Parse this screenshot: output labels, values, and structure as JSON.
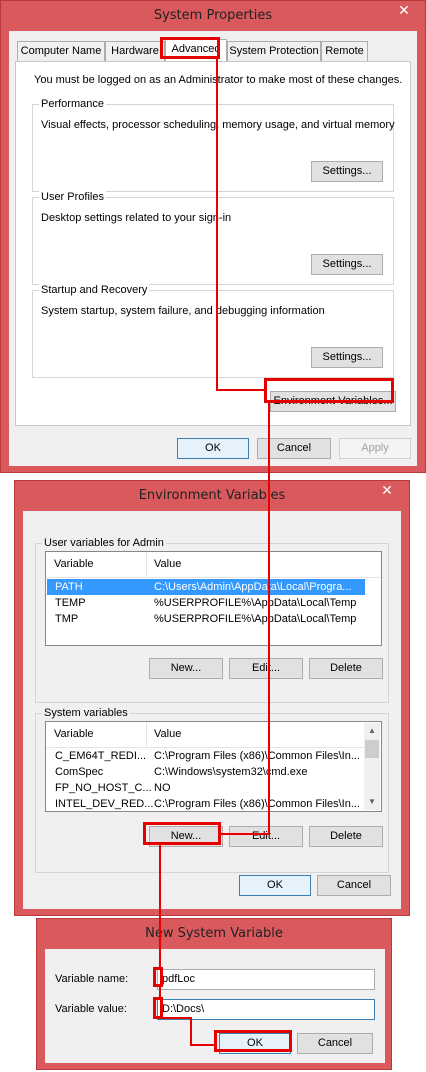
{
  "colors": {
    "frame": "#d9595d",
    "highlight": "#e60000",
    "selection": "#3399ff"
  },
  "icons": {
    "close": "close-icon",
    "scroll_up": "scroll-up-arrow-icon",
    "scroll_down": "scroll-down-arrow-icon"
  },
  "system_properties": {
    "title": "System Properties",
    "close_glyph": "✕",
    "tabs": [
      {
        "label": "Computer Name"
      },
      {
        "label": "Hardware"
      },
      {
        "label": "Advanced",
        "active": true
      },
      {
        "label": "System Protection"
      },
      {
        "label": "Remote"
      }
    ],
    "admin_note": "You must be logged on as an Administrator to make most of these changes.",
    "performance": {
      "title": "Performance",
      "description": "Visual effects, processor scheduling, memory usage, and virtual memory",
      "settings_label": "Settings..."
    },
    "user_profiles": {
      "title": "User Profiles",
      "description": "Desktop settings related to your sign-in",
      "settings_label": "Settings..."
    },
    "startup_recovery": {
      "title": "Startup and Recovery",
      "description": "System startup, system failure, and debugging information",
      "settings_label": "Settings..."
    },
    "env_vars_label": "Environment Variables...",
    "ok_label": "OK",
    "cancel_label": "Cancel",
    "apply_label": "Apply"
  },
  "environment_variables": {
    "title": "Environment Variables",
    "close_glyph": "✕",
    "user_section_label": "User variables for Admin",
    "columns": {
      "variable": "Variable",
      "value": "Value"
    },
    "user_vars": [
      {
        "name": "PATH",
        "value": "C:\\Users\\Admin\\AppData\\Local\\Progra...",
        "selected": true
      },
      {
        "name": "TEMP",
        "value": "%USERPROFILE%\\AppData\\Local\\Temp"
      },
      {
        "name": "TMP",
        "value": "%USERPROFILE%\\AppData\\Local\\Temp"
      }
    ],
    "system_section_label": "System variables",
    "system_vars": [
      {
        "name": "C_EM64T_REDI...",
        "value": "C:\\Program Files (x86)\\Common Files\\In..."
      },
      {
        "name": "ComSpec",
        "value": "C:\\Windows\\system32\\cmd.exe"
      },
      {
        "name": "FP_NO_HOST_C...",
        "value": "NO"
      },
      {
        "name": "INTEL_DEV_RED...",
        "value": "C:\\Program Files (x86)\\Common Files\\In..."
      }
    ],
    "new_label": "New...",
    "edit_label": "Edit...",
    "delete_label": "Delete",
    "ok_label": "OK",
    "cancel_label": "Cancel"
  },
  "new_system_variable": {
    "title": "New System Variable",
    "name_label": "Variable name:",
    "name_value": "pdfLoc",
    "value_label": "Variable value:",
    "value_value": "D:\\Docs\\",
    "ok_label": "OK",
    "cancel_label": "Cancel"
  }
}
